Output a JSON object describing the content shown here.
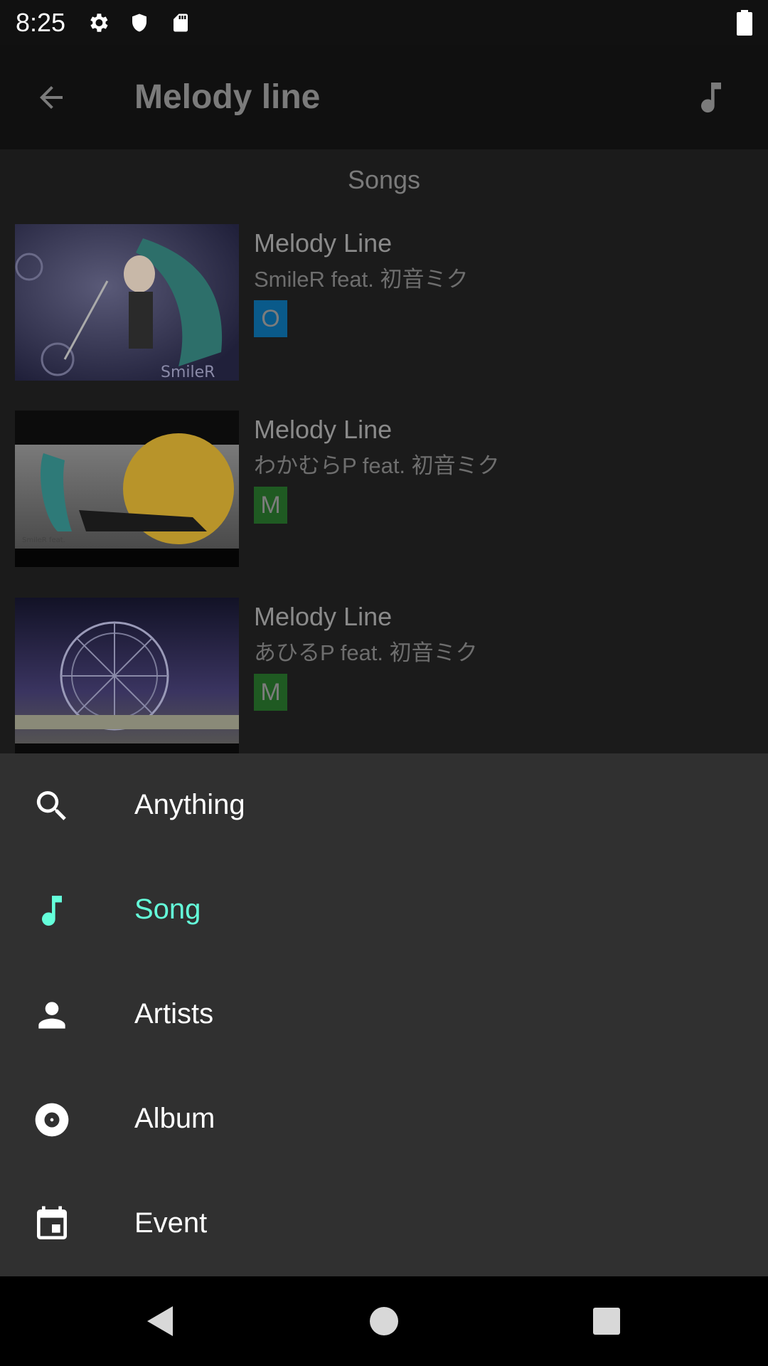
{
  "status_bar": {
    "time": "8:25",
    "icons": [
      "gear-icon",
      "shield-icon",
      "sd-card-icon"
    ],
    "battery_icon": "battery-icon"
  },
  "app_bar": {
    "back_icon": "arrow-left-icon",
    "title": "Melody line",
    "action_icon": "music-note-icon"
  },
  "content": {
    "section_header": "Songs",
    "songs": [
      {
        "title": "Melody Line",
        "artist": "SmileR feat. 初音ミク",
        "badge": "O",
        "badge_color": "#0a5a8a"
      },
      {
        "title": "Melody Line",
        "artist": "わかむらP feat. 初音ミク",
        "badge": "M",
        "badge_color": "#1f5a22"
      },
      {
        "title": "Melody Line",
        "artist": "あひるP feat. 初音ミク",
        "badge": "M",
        "badge_color": "#1f5a22"
      }
    ]
  },
  "bottom_sheet": {
    "items": [
      {
        "label": "Anything",
        "icon": "search-icon",
        "active": false
      },
      {
        "label": "Song",
        "icon": "music-note-icon",
        "active": true
      },
      {
        "label": "Artists",
        "icon": "person-icon",
        "active": false
      },
      {
        "label": "Album",
        "icon": "disc-icon",
        "active": false
      },
      {
        "label": "Event",
        "icon": "calendar-icon",
        "active": false
      }
    ],
    "accent_color": "#64ffda"
  },
  "nav_bar": {
    "back": "nav-back-icon",
    "home": "nav-home-icon",
    "recents": "nav-recents-icon"
  }
}
